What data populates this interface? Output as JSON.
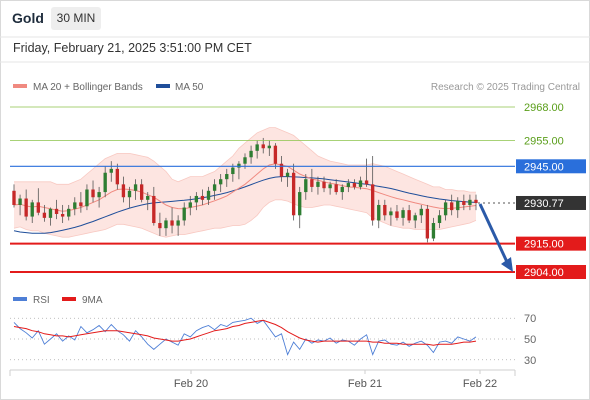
{
  "header": {
    "instrument": "Gold",
    "timeframe": "30 MIN",
    "datetime": "Friday, February 21, 2025 3:51:00 PM CET"
  },
  "legend": {
    "ma20_label": "MA 20 + Bollinger Bands",
    "ma50_label": "MA 50",
    "credit": "Research © 2025 Trading Central"
  },
  "rsi_legend": {
    "rsi_label": "RSI",
    "ma9_label": "9MA"
  },
  "chart_data": [
    {
      "type": "candlestick",
      "x_labels": [
        "Feb 20",
        "Feb 21",
        "Feb 22"
      ],
      "y_range": [
        2908,
        2972
      ],
      "levels": [
        {
          "label": "2968.00",
          "value": 2968.0,
          "style": "green-thin"
        },
        {
          "label": "2955.00",
          "value": 2955.0,
          "style": "green-thin"
        },
        {
          "label": "2945.00",
          "value": 2945.0,
          "style": "blue"
        },
        {
          "label": "2930.77",
          "value": 2930.77,
          "style": "last-price"
        },
        {
          "label": "2915.00",
          "value": 2915.0,
          "style": "red-thick"
        },
        {
          "label": "2904.00",
          "value": 2904.0,
          "style": "red-thick"
        }
      ],
      "candles": [
        [
          2935.5,
          2938,
          2929,
          2930
        ],
        [
          2930,
          2934,
          2926,
          2932.5
        ],
        [
          2932.5,
          2936,
          2924,
          2925.5
        ],
        [
          2925.5,
          2932,
          2923,
          2931
        ],
        [
          2931,
          2936.5,
          2926,
          2927
        ],
        [
          2927,
          2930,
          2923.5,
          2925
        ],
        [
          2925,
          2929,
          2922,
          2928.5
        ],
        [
          2928.5,
          2932,
          2924.5,
          2926.5
        ],
        [
          2926.5,
          2930,
          2923,
          2925.5
        ],
        [
          2925.5,
          2930,
          2924,
          2928.5
        ],
        [
          2928.5,
          2933,
          2926,
          2931
        ],
        [
          2931,
          2935,
          2927,
          2929.5
        ],
        [
          2929.5,
          2938,
          2928,
          2936
        ],
        [
          2936,
          2939.5,
          2931,
          2933
        ],
        [
          2933,
          2937,
          2929,
          2935
        ],
        [
          2935,
          2945,
          2933,
          2942.5
        ],
        [
          2942.5,
          2947,
          2939,
          2944
        ],
        [
          2944,
          2946,
          2936,
          2938
        ],
        [
          2938,
          2941,
          2931,
          2933
        ],
        [
          2933,
          2937,
          2929,
          2935.5
        ],
        [
          2935.5,
          2940,
          2932,
          2938
        ],
        [
          2938,
          2940,
          2931,
          2932
        ],
        [
          2932,
          2935,
          2928,
          2933.5
        ],
        [
          2933.5,
          2937,
          2922,
          2923
        ],
        [
          2923,
          2927,
          2918,
          2921
        ],
        [
          2921,
          2925,
          2918,
          2924
        ],
        [
          2924,
          2929,
          2919,
          2922
        ],
        [
          2922,
          2926,
          2918,
          2924
        ],
        [
          2924,
          2931,
          2922,
          2929
        ],
        [
          2929,
          2933.5,
          2926,
          2931
        ],
        [
          2931,
          2935,
          2928,
          2933.5
        ],
        [
          2933.5,
          2936,
          2930,
          2932
        ],
        [
          2932,
          2937,
          2930,
          2935.5
        ],
        [
          2935.5,
          2940,
          2932,
          2938
        ],
        [
          2938,
          2942,
          2935,
          2940
        ],
        [
          2940,
          2944,
          2937,
          2942
        ],
        [
          2942,
          2946,
          2939,
          2944.5
        ],
        [
          2944.5,
          2947,
          2940,
          2946
        ],
        [
          2946,
          2950,
          2944,
          2948.5
        ],
        [
          2948.5,
          2953,
          2946,
          2951
        ],
        [
          2951,
          2955,
          2948,
          2953.5
        ],
        [
          2953.5,
          2956,
          2950,
          2952
        ],
        [
          2952,
          2955,
          2949,
          2953
        ],
        [
          2953,
          2954,
          2944,
          2946
        ],
        [
          2946,
          2949,
          2939,
          2941
        ],
        [
          2941,
          2944,
          2937,
          2942.5
        ],
        [
          2942.5,
          2946,
          2924,
          2926
        ],
        [
          2926,
          2937,
          2921,
          2935
        ],
        [
          2935,
          2942,
          2932,
          2940
        ],
        [
          2940,
          2944,
          2935,
          2937
        ],
        [
          2937,
          2941,
          2934,
          2939
        ],
        [
          2939,
          2941,
          2935,
          2936.5
        ],
        [
          2936.5,
          2939,
          2934,
          2938
        ],
        [
          2938,
          2940,
          2934,
          2935
        ],
        [
          2935,
          2938,
          2932,
          2937
        ],
        [
          2937,
          2940,
          2935,
          2938.5
        ],
        [
          2938.5,
          2940,
          2936,
          2937
        ],
        [
          2937,
          2941,
          2936,
          2939.5
        ],
        [
          2939.5,
          2948,
          2937,
          2938
        ],
        [
          2938,
          2949,
          2922,
          2924
        ],
        [
          2924,
          2932,
          2921,
          2930
        ],
        [
          2930,
          2932,
          2924,
          2926
        ],
        [
          2926,
          2929,
          2922,
          2927.5
        ],
        [
          2927.5,
          2930,
          2924,
          2925
        ],
        [
          2925,
          2929,
          2922,
          2928
        ],
        [
          2928,
          2930,
          2923,
          2924
        ],
        [
          2924,
          2927,
          2921,
          2926
        ],
        [
          2926,
          2930,
          2923,
          2928.5
        ],
        [
          2928.5,
          2930,
          2915.5,
          2917
        ],
        [
          2917,
          2925,
          2916,
          2923
        ],
        [
          2923,
          2928,
          2921,
          2926
        ],
        [
          2926,
          2932,
          2924,
          2931
        ],
        [
          2931,
          2934,
          2926,
          2928
        ],
        [
          2928,
          2933,
          2925,
          2931.5
        ],
        [
          2931.5,
          2934,
          2928,
          2930
        ],
        [
          2930,
          2934,
          2928,
          2932
        ],
        [
          2932,
          2934,
          2928,
          2930.77
        ]
      ],
      "ma20": [
        2930,
        2930.3,
        2929.6,
        2929.2,
        2929.5,
        2929,
        2928.5,
        2928,
        2927.6,
        2927.8,
        2928.4,
        2929,
        2930,
        2931,
        2932,
        2933.5,
        2935,
        2936,
        2936.2,
        2936,
        2935.6,
        2935,
        2934,
        2933,
        2931.5,
        2930,
        2929,
        2928.6,
        2928.5,
        2929,
        2929.5,
        2930,
        2930.8,
        2931.6,
        2932.5,
        2933.5,
        2935,
        2936.5,
        2938,
        2940,
        2942,
        2944,
        2945.5,
        2946,
        2945.5,
        2945,
        2943.5,
        2942,
        2941,
        2940,
        2939.6,
        2939,
        2938.4,
        2938,
        2937.5,
        2937,
        2936.8,
        2936.6,
        2936.3,
        2935.6,
        2934.8,
        2934,
        2933.2,
        2932.5,
        2932,
        2931.4,
        2930.8,
        2930.3,
        2929.7,
        2929.2,
        2928.8,
        2928.6,
        2928.7,
        2928.9,
        2929.2,
        2929.5,
        2929.8
      ],
      "bb_upper": [
        2939,
        2939,
        2939,
        2939,
        2939,
        2939,
        2939,
        2938,
        2938,
        2938,
        2939,
        2940,
        2942,
        2944,
        2946,
        2948,
        2949,
        2950,
        2950,
        2950,
        2949.5,
        2949,
        2948.5,
        2947,
        2945,
        2943,
        2940,
        2939,
        2940,
        2941,
        2941,
        2941,
        2942,
        2943,
        2945,
        2947,
        2949,
        2952,
        2954,
        2956,
        2958,
        2959,
        2960,
        2960,
        2959,
        2958,
        2957,
        2955,
        2953,
        2951,
        2949,
        2948,
        2947,
        2946.5,
        2946,
        2945.5,
        2945.5,
        2945.5,
        2945.5,
        2946,
        2945.5,
        2945,
        2944,
        2943,
        2942,
        2941,
        2940,
        2939,
        2938,
        2937,
        2937,
        2936,
        2936,
        2935.5,
        2935.5,
        2935,
        2935
      ],
      "bb_lower": [
        2921,
        2921.5,
        2920.5,
        2920,
        2920,
        2919,
        2918.5,
        2918,
        2917.5,
        2917.5,
        2918,
        2918.5,
        2919,
        2919.5,
        2920,
        2920.5,
        2921.5,
        2922.5,
        2922.5,
        2922,
        2921.5,
        2921,
        2920,
        2919,
        2918,
        2917.5,
        2918,
        2918.5,
        2918.5,
        2919,
        2919.5,
        2920,
        2920.5,
        2921,
        2921,
        2921.5,
        2922,
        2922,
        2922.5,
        2924,
        2926,
        2929,
        2931,
        2932,
        2932,
        2931.5,
        2930.5,
        2929.5,
        2929,
        2929,
        2929.5,
        2930,
        2930,
        2929.5,
        2929,
        2928.5,
        2928,
        2927.5,
        2927,
        2925,
        2924,
        2923,
        2922,
        2921.5,
        2921,
        2921,
        2920.5,
        2920.5,
        2920.5,
        2920.5,
        2920.5,
        2921,
        2921.5,
        2922,
        2922.5,
        2923,
        2924
      ],
      "ma50": [
        2920,
        2919.5,
        2919.3,
        2919,
        2919,
        2919,
        2919.3,
        2919.7,
        2920.2,
        2920.7,
        2921.3,
        2922,
        2922.8,
        2923.6,
        2924.5,
        2925.4,
        2926.3,
        2927.2,
        2928,
        2928.8,
        2929.4,
        2930,
        2930.5,
        2930.8,
        2931,
        2931.2,
        2931.4,
        2931.6,
        2931.8,
        2932.1,
        2932.4,
        2932.8,
        2933.2,
        2933.7,
        2934.2,
        2934.8,
        2935.5,
        2936.2,
        2937,
        2937.9,
        2938.8,
        2939.6,
        2940.3,
        2940.8,
        2941,
        2941,
        2940.9,
        2940.8,
        2940.6,
        2940.5,
        2940.3,
        2940.1,
        2939.8,
        2939.5,
        2939.2,
        2938.9,
        2938.6,
        2938.3,
        2938,
        2937.6,
        2937.2,
        2936.8,
        2936.4,
        2935.8,
        2935.2,
        2934.6,
        2934.1,
        2933.6,
        2933.1,
        2932.7,
        2932.3,
        2932,
        2931.7,
        2931.5,
        2931.3,
        2931.1,
        2931
      ]
    },
    {
      "type": "line",
      "title": "RSI",
      "y_ticks": [
        70,
        50,
        30
      ],
      "y_range": [
        24,
        76
      ],
      "series": [
        {
          "name": "RSI",
          "values": [
            66,
            60,
            56,
            51,
            58,
            45,
            50,
            55,
            48,
            53,
            49,
            62,
            56,
            59,
            63,
            57,
            64,
            58,
            54,
            48,
            58,
            52,
            45,
            40,
            45,
            50,
            47,
            44,
            55,
            52,
            58,
            61,
            63,
            59,
            64,
            62,
            66,
            67,
            68,
            70,
            65,
            68,
            60,
            52,
            55,
            35,
            47,
            40,
            50,
            46,
            49,
            48,
            51,
            46,
            49,
            48,
            44,
            50,
            54,
            35,
            48,
            49,
            45,
            44,
            47,
            43,
            46,
            48,
            44,
            37,
            47,
            48,
            46,
            52,
            50,
            48,
            52
          ]
        },
        {
          "name": "9MA",
          "values": [
            62,
            61,
            60,
            58,
            57,
            55,
            54,
            53,
            53,
            52,
            53,
            54,
            55,
            56,
            57,
            58,
            58,
            58,
            57,
            56,
            55,
            54,
            53,
            51,
            50,
            49,
            48,
            48,
            49,
            50,
            52,
            54,
            56,
            58,
            59,
            60,
            62,
            63,
            65,
            66,
            67,
            68,
            66,
            64,
            61,
            57,
            54,
            51,
            49,
            48,
            47,
            48,
            48,
            48,
            48,
            48,
            48,
            48,
            48,
            47,
            47,
            46,
            46,
            46,
            45,
            45,
            45,
            45,
            45,
            44,
            45,
            45,
            45,
            46,
            47,
            47,
            48
          ]
        }
      ]
    }
  ]
}
